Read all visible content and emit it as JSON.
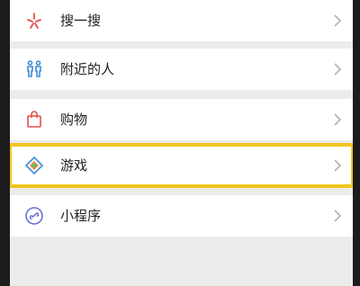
{
  "menu": {
    "items": [
      {
        "label": "搜一搜",
        "icon": "search-star-icon"
      },
      {
        "label": "附近的人",
        "icon": "nearby-people-icon"
      },
      {
        "label": "购物",
        "icon": "shopping-bag-icon"
      },
      {
        "label": "游戏",
        "icon": "game-diamond-icon",
        "highlighted": true
      },
      {
        "label": "小程序",
        "icon": "mini-program-icon"
      }
    ]
  },
  "colors": {
    "highlight": "#f2c51f",
    "background": "#ececec",
    "row": "#ffffff",
    "chevron": "#b3b3b3"
  }
}
